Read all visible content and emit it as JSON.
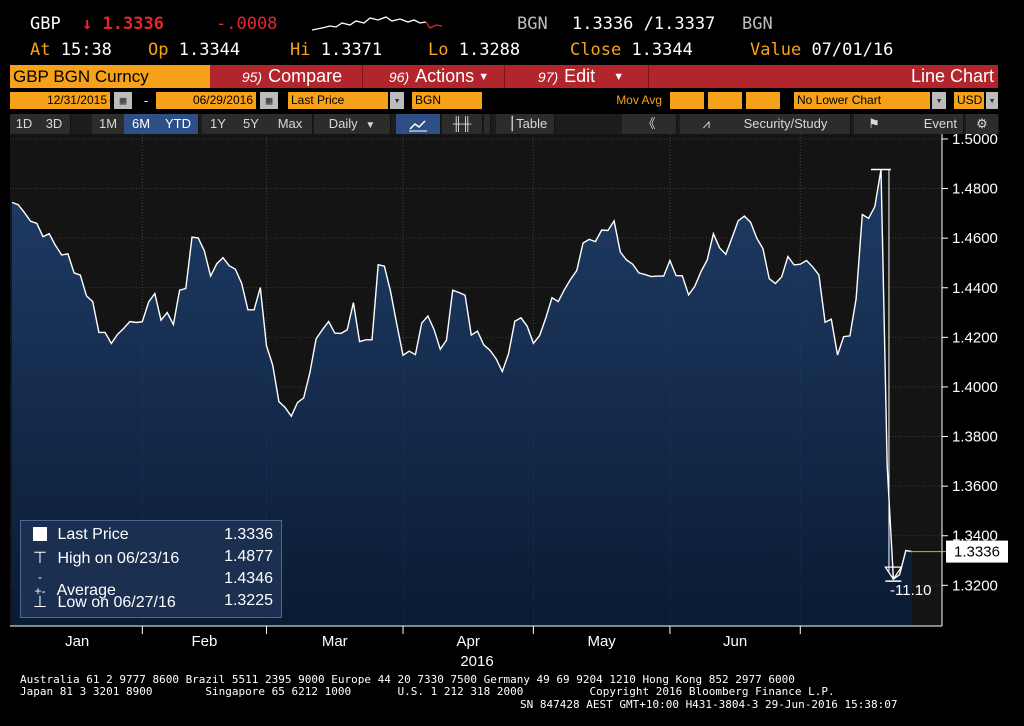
{
  "quote": {
    "ticker": "GBP",
    "arrow": "↓",
    "price": "1.3336",
    "change": "-.0008",
    "src_left": "BGN",
    "bid_ask": "1.3336 /1.3337",
    "src_right": "BGN",
    "at_label": "At",
    "at_value": "15:38",
    "op_label": "Op",
    "op_value": "1.3344",
    "hi_label": "Hi",
    "hi_value": "1.3371",
    "lo_label": "Lo",
    "lo_value": "1.3288",
    "close_label": "Close",
    "close_value": "1.3344",
    "value_label": "Value",
    "value_date": "07/01/16"
  },
  "function_bar": {
    "security": "GBP BGN Curncy",
    "compare_num": "95)",
    "compare_label": "Compare",
    "actions_num": "96)",
    "actions_label": "Actions",
    "edit_num": "97)",
    "edit_label": "Edit",
    "chart_type": "Line Chart"
  },
  "inputs": {
    "start_date": "12/31/2015",
    "separator": "-",
    "end_date": "06/29/2016",
    "field": "Last Price",
    "source": "BGN",
    "mov_avg_label": "Mov Avg",
    "lower_chart": "No Lower Chart",
    "currency": "USD"
  },
  "toolbar": {
    "periods": [
      "1D",
      "3D",
      "1M",
      "6M",
      "YTD",
      "1Y",
      "5Y",
      "Max"
    ],
    "selected_period": "6M",
    "frequency": "Daily",
    "table_label": "Table",
    "security_study": "Security/Study",
    "event_label": "Event"
  },
  "legend": {
    "last_label": "Last Price",
    "last_value": "1.3336",
    "high_label": "High on 06/23/16",
    "high_value": "1.4877",
    "avg_label": "Average",
    "avg_value": "1.4346",
    "low_label": "Low on 06/27/16",
    "low_value": "1.3225"
  },
  "annotations": {
    "last_badge": "1.3336",
    "pct_drop": "-11.10"
  },
  "chart_data": {
    "type": "line",
    "series": [
      {
        "name": "Last Price",
        "values": [
          1.4744,
          1.4735,
          1.4703,
          1.4668,
          1.466,
          1.4606,
          1.4618,
          1.4571,
          1.4532,
          1.4537,
          1.446,
          1.4451,
          1.4367,
          1.4344,
          1.422,
          1.422,
          1.4175,
          1.4212,
          1.4236,
          1.4264,
          1.426,
          1.4263,
          1.4342,
          1.4377,
          1.4269,
          1.43,
          1.4252,
          1.439,
          1.4397,
          1.4604,
          1.4601,
          1.4548,
          1.4447,
          1.4497,
          1.4521,
          1.4489,
          1.4475,
          1.4417,
          1.4311,
          1.4311,
          1.4401,
          1.4166,
          1.4088,
          1.3941,
          1.3917,
          1.3882,
          1.3937,
          1.3956,
          1.4058,
          1.4194,
          1.423,
          1.4264,
          1.4217,
          1.4216,
          1.423,
          1.434,
          1.4183,
          1.419,
          1.419,
          1.4493,
          1.4487,
          1.4384,
          1.4253,
          1.4128,
          1.4144,
          1.413,
          1.4257,
          1.4286,
          1.4231,
          1.4152,
          1.4189,
          1.439,
          1.4381,
          1.437,
          1.4209,
          1.4225,
          1.417,
          1.4148,
          1.4114,
          1.4062,
          1.4135,
          1.4265,
          1.4279,
          1.4245,
          1.4176,
          1.4207,
          1.4278,
          1.436,
          1.4344,
          1.4392,
          1.4434,
          1.447,
          1.458,
          1.4595,
          1.4586,
          1.4633,
          1.4631,
          1.4669,
          1.4544,
          1.4512,
          1.4495,
          1.446,
          1.4453,
          1.4445,
          1.4447,
          1.4447,
          1.451,
          1.4449,
          1.4448,
          1.4371,
          1.4406,
          1.4465,
          1.4512,
          1.4618,
          1.4561,
          1.4535,
          1.4601,
          1.467,
          1.4689,
          1.4664,
          1.46,
          1.4557,
          1.4437,
          1.4417,
          1.4444,
          1.4526,
          1.4492,
          1.4495,
          1.451,
          1.4484,
          1.4452,
          1.4261,
          1.4273,
          1.4129,
          1.4203,
          1.4206,
          1.4355,
          1.4695,
          1.468,
          1.4727,
          1.4877,
          1.368,
          1.3225,
          1.3243,
          1.334,
          1.3336
        ]
      }
    ],
    "x_months": [
      "Jan",
      "Feb",
      "Mar",
      "Apr",
      "May",
      "Jun"
    ],
    "x_year": "2016",
    "y_ticks": [
      "1.5000",
      "1.4800",
      "1.4600",
      "1.4400",
      "1.4200",
      "1.4000",
      "1.3800",
      "1.3600",
      "1.3400",
      "1.3200"
    ],
    "ylim": [
      1.3036,
      1.502
    ],
    "high": 1.4877,
    "low": 1.3225,
    "average": 1.4346,
    "colors": {
      "line": "#ffffff",
      "fill_top": "#1e3a63",
      "fill_bottom": "#0c1d36",
      "background": "#141414"
    }
  },
  "footer": {
    "line1": "Australia 61 2 9777 8600 Brazil 5511 2395 9000 Europe 44 20 7330 7500 Germany 49 69 9204 1210 Hong Kong 852 2977 6000",
    "line2": "Japan 81 3 3201 8900        Singapore 65 6212 1000       U.S. 1 212 318 2000          Copyright 2016 Bloomberg Finance L.P.",
    "line3": "SN 847428 AEST GMT+10:00 H431-3804-3 29-Jun-2016 15:38:07"
  }
}
